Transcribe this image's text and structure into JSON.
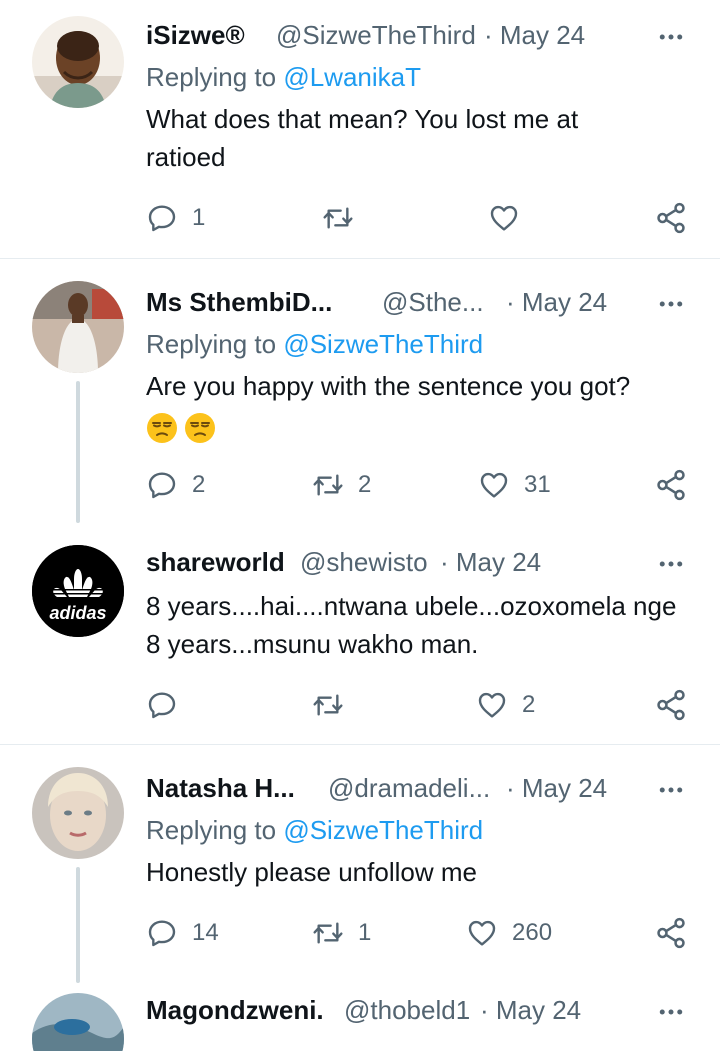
{
  "colors": {
    "text": "#0f1419",
    "secondary": "#536471",
    "link": "#1d9bf0",
    "divider": "#e6ecf0",
    "thread_line": "#cfd9de"
  },
  "icons": {
    "more": "more-horizontal-icon",
    "reply": "reply-bubble-icon",
    "retweet": "retweet-icon",
    "like": "heart-icon",
    "share": "share-icon"
  },
  "tweets": [
    {
      "name": "iSizwe®",
      "handle": "@SizweTheThird",
      "date": "· May 24",
      "replying_prefix": "Replying to ",
      "replying_to": "@LwanikaT",
      "text": "What does that mean? You lost me at ratioed",
      "replies": "1",
      "retweets": "",
      "likes": ""
    },
    {
      "name": "Ms SthembiD...",
      "handle": "@Sthe...",
      "date": "· May 24",
      "replying_prefix": "Replying to ",
      "replying_to": "@SizweTheThird",
      "text": "Are you happy with the sentence you got?",
      "emoji": "😒😒",
      "replies": "2",
      "retweets": "2",
      "likes": "31"
    },
    {
      "name": "shareworld",
      "handle": "@shewisto",
      "date": "· May 24",
      "avatar_text": "adidas",
      "text": "8 years....hai....ntwana ubele...ozoxomela nge 8 years...msunu wakho man.",
      "replies": "",
      "retweets": "",
      "likes": "2"
    },
    {
      "name": "Natasha H...",
      "handle": "@dramadeli...",
      "date": "· May 24",
      "replying_prefix": "Replying to ",
      "replying_to": "@SizweTheThird",
      "text": "Honestly please unfollow me",
      "replies": "14",
      "retweets": "1",
      "likes": "260"
    },
    {
      "name": "Magondzweni.",
      "handle": "@thobeld1",
      "date": "· May 24"
    }
  ]
}
